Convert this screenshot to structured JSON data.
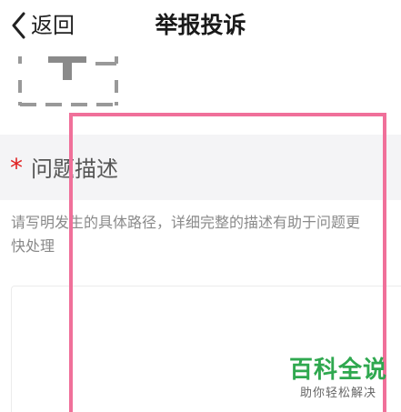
{
  "header": {
    "back_label": "返回",
    "title": "举报投诉"
  },
  "section": {
    "required_mark": "*",
    "title": "问题描述"
  },
  "hint": {
    "line1": "请写明发生的具体路径，详细完整的描述有助于问题更",
    "line2": "快处理"
  },
  "watermark": {
    "title": "百科全说",
    "subtitle": "助你轻松解决"
  },
  "colors": {
    "required": "#e02020",
    "highlight": "#f0709a",
    "watermark": "#2fa84f",
    "section_bg": "#f4f4f6"
  }
}
